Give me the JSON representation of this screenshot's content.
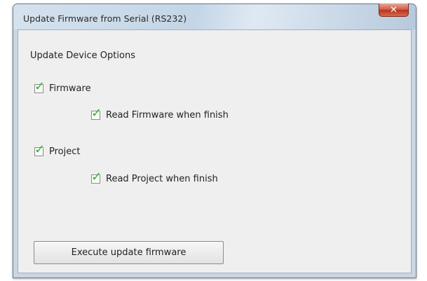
{
  "window": {
    "title": "Update Firmware from Serial (RS232)",
    "close_label": "✕"
  },
  "options": {
    "group_label": "Update Device Options",
    "firmware": {
      "label": "Firmware",
      "checked": true
    },
    "read_firmware": {
      "label": "Read Firmware when finish",
      "checked": true
    },
    "project": {
      "label": "Project",
      "checked": true
    },
    "read_project": {
      "label": "Read Project when finish",
      "checked": true
    }
  },
  "actions": {
    "execute_label": "Execute update firmware"
  },
  "icons": {
    "checkmark": "checkmark-icon",
    "close": "close-icon"
  },
  "colors": {
    "checkmark": "#2eb52e",
    "close_button": "#cf5b45",
    "title_bar": "#c3d5e6"
  }
}
